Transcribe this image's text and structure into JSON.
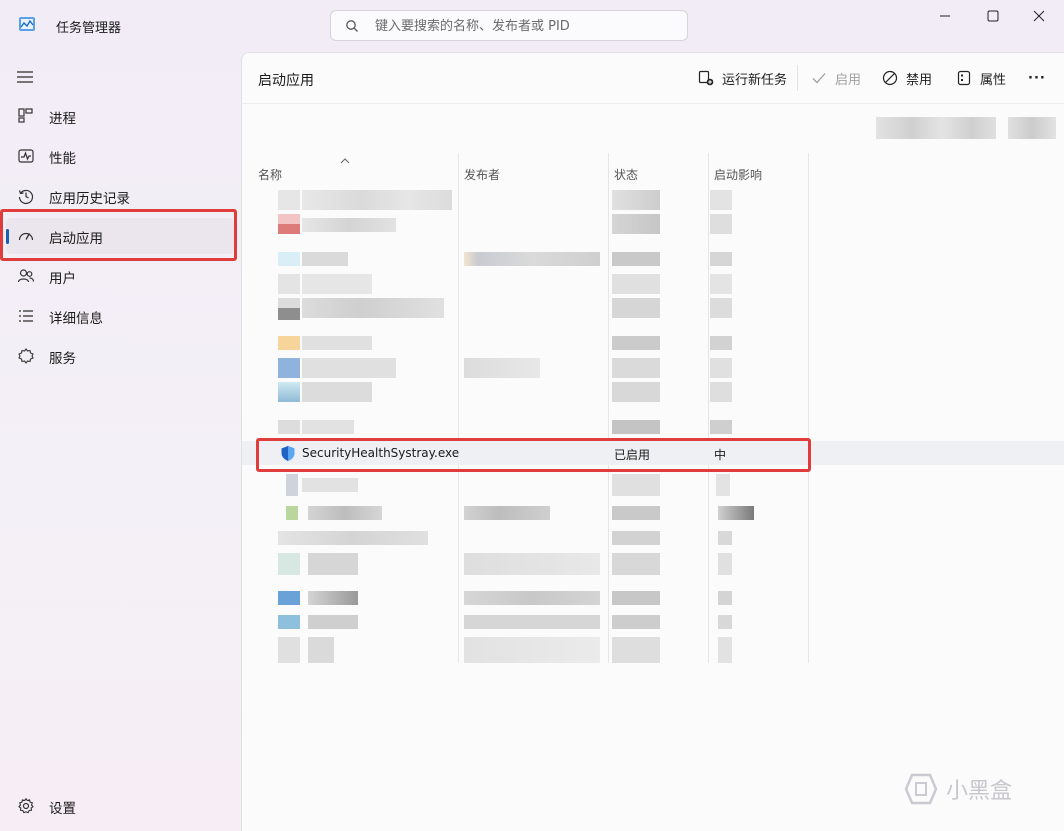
{
  "window": {
    "title": "任务管理器",
    "search_placeholder": "键入要搜索的名称、发布者或 PID"
  },
  "sidebar": {
    "items": [
      {
        "label": "进程",
        "icon": "processes-icon"
      },
      {
        "label": "性能",
        "icon": "performance-icon"
      },
      {
        "label": "应用历史记录",
        "icon": "history-icon"
      },
      {
        "label": "启动应用",
        "icon": "startup-icon",
        "active": true
      },
      {
        "label": "用户",
        "icon": "users-icon"
      },
      {
        "label": "详细信息",
        "icon": "details-icon"
      },
      {
        "label": "服务",
        "icon": "services-icon"
      }
    ],
    "settings_label": "设置"
  },
  "main": {
    "title": "启动应用",
    "toolbar": {
      "run_new_task": "运行新任务",
      "enable": "启用",
      "disable": "禁用",
      "properties": "属性",
      "more": "···"
    },
    "columns": [
      "名称",
      "发布者",
      "状态",
      "启动影响"
    ],
    "highlighted_row": {
      "name": "SecurityHealthSystray.exe",
      "publisher": "",
      "status": "已启用",
      "impact": "中"
    }
  },
  "colors": {
    "accent": "#1a5fb4",
    "highlight_box": "#e03c3c"
  }
}
